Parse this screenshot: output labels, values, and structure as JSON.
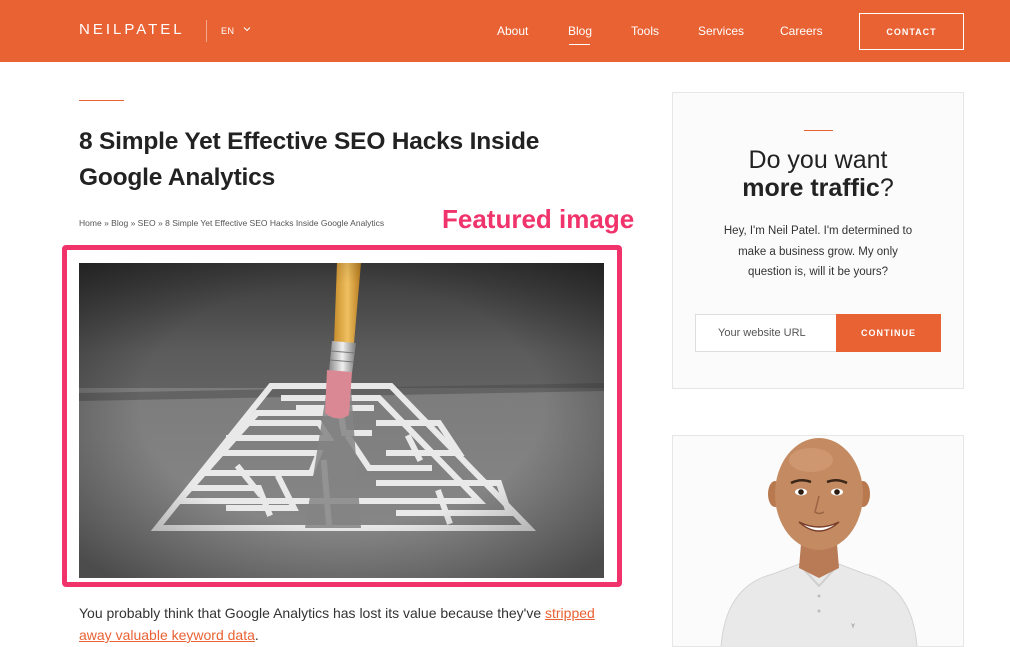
{
  "header": {
    "logo": "NEILPATEL",
    "language": "EN",
    "nav": [
      "About",
      "Blog",
      "Tools",
      "Services",
      "Careers"
    ],
    "active_nav": "Blog",
    "contact_label": "CONTACT"
  },
  "article": {
    "title": "8 Simple Yet Effective SEO Hacks Inside Google Analytics",
    "breadcrumb": [
      "Home",
      "Blog",
      "SEO",
      "8 Simple Yet Effective SEO Hacks Inside Google Analytics"
    ],
    "breadcrumb_separator": "»",
    "annotation": "Featured image",
    "intro_text": "You probably think that Google Analytics has lost its value because they've ",
    "intro_link": "stripped away valuable keyword data",
    "intro_end": "."
  },
  "sidebar": {
    "heading_line1": "Do you want",
    "heading_bold": "more traffic",
    "heading_end": "?",
    "body": "Hey, I'm Neil Patel. I'm determined to make a business grow. My only question is, will it be yours?",
    "url_placeholder": "Your website URL",
    "continue_label": "CONTINUE"
  },
  "colors": {
    "brand": "#e86233",
    "annotation": "#f0336b"
  },
  "icons": {
    "language_toggle": "chevron-down-icon"
  }
}
